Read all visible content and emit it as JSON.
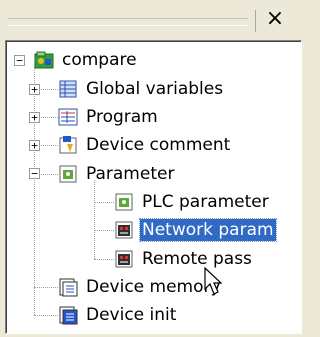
{
  "window": {
    "close_glyph": "×"
  },
  "tree": {
    "root": {
      "label": "compare",
      "icon": "project-icon"
    },
    "items": [
      {
        "label": "Global variables",
        "icon": "global-variables-icon"
      },
      {
        "label": "Program",
        "icon": "program-icon"
      },
      {
        "label": "Device comment",
        "icon": "device-comment-icon"
      },
      {
        "label": "Parameter",
        "icon": "parameter-icon"
      },
      {
        "label": "PLC parameter",
        "icon": "plc-parameter-icon"
      },
      {
        "label": "Network param",
        "icon": "network-parameter-icon",
        "selected": true
      },
      {
        "label": "Remote pass",
        "icon": "remote-password-icon"
      },
      {
        "label": "Device memory",
        "icon": "device-memory-icon"
      },
      {
        "label": "Device init",
        "icon": "device-init-icon"
      }
    ]
  },
  "colors": {
    "selection": "#316ac5",
    "panel_bg": "#ece9d8"
  }
}
